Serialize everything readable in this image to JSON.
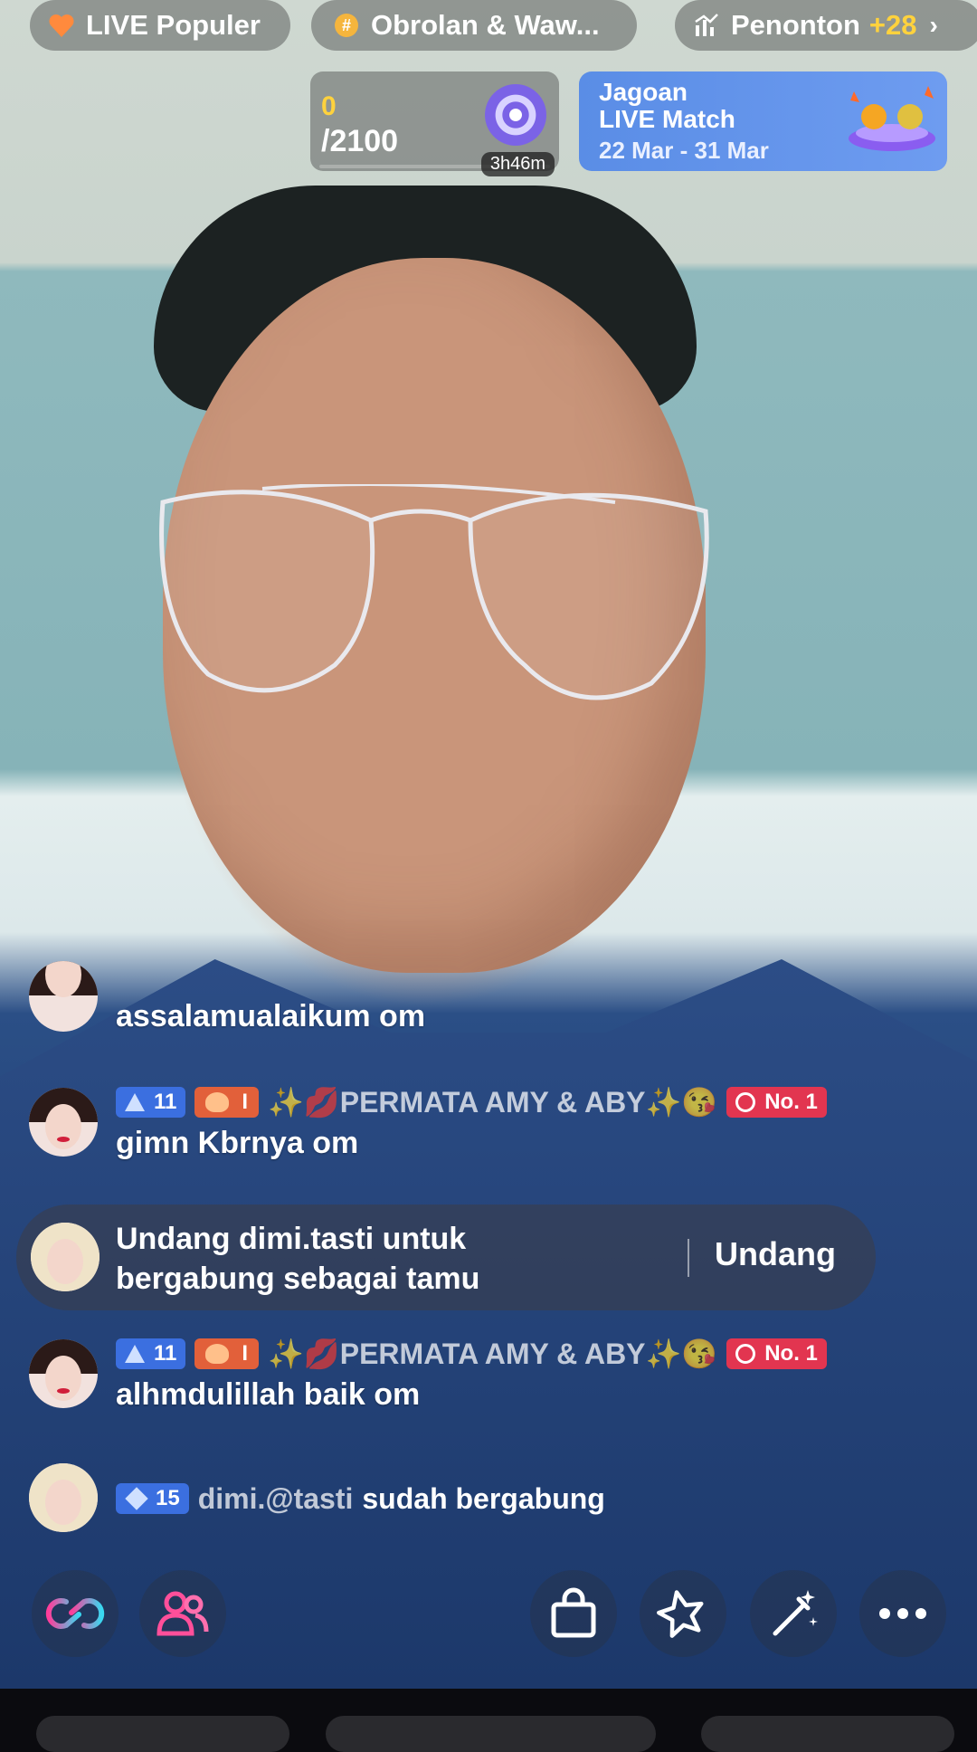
{
  "top_pills": {
    "popular": "LIVE Populer",
    "category": "Obrolan & Waw...",
    "viewers_label": "Penonton",
    "viewers_delta": "+28"
  },
  "quest": {
    "progress": "0",
    "goal": "/2100",
    "timer": "3h46m"
  },
  "match_banner": {
    "title_line1": "Jagoan",
    "title_line2": "LIVE Match",
    "dates": "22 Mar - 31 Mar"
  },
  "chat": {
    "partial_message": "assalamualaikum om",
    "messages": [
      {
        "level": "11",
        "fan_level": "I",
        "username": "✨💋PERMATA AMY & ABY✨😘",
        "rank": "No. 1",
        "text": "gimn Kbrnya om"
      },
      {
        "level": "11",
        "fan_level": "I",
        "username": "✨💋PERMATA AMY & ABY✨😘",
        "rank": "No. 1",
        "text": "alhmdulillah baik om"
      }
    ],
    "invite": {
      "line1": "Undang dimi.tasti untuk",
      "line2": "bergabung sebagai tamu",
      "button": "Undang"
    },
    "join": {
      "level": "15",
      "username": "dimi.@tasti",
      "text": "sudah bergabung"
    }
  },
  "toolbar": {
    "icons": [
      "link-icon",
      "guests-icon",
      "shopping-bag-icon",
      "star-effects-icon",
      "magic-wand-icon",
      "more-icon"
    ]
  },
  "colors": {
    "accent_yellow": "#ffd23d",
    "level_blue": "#3b6fe0",
    "fan_orange": "#e2603a",
    "rank_red": "#e23550",
    "banner_blue": "#5a8de6"
  }
}
